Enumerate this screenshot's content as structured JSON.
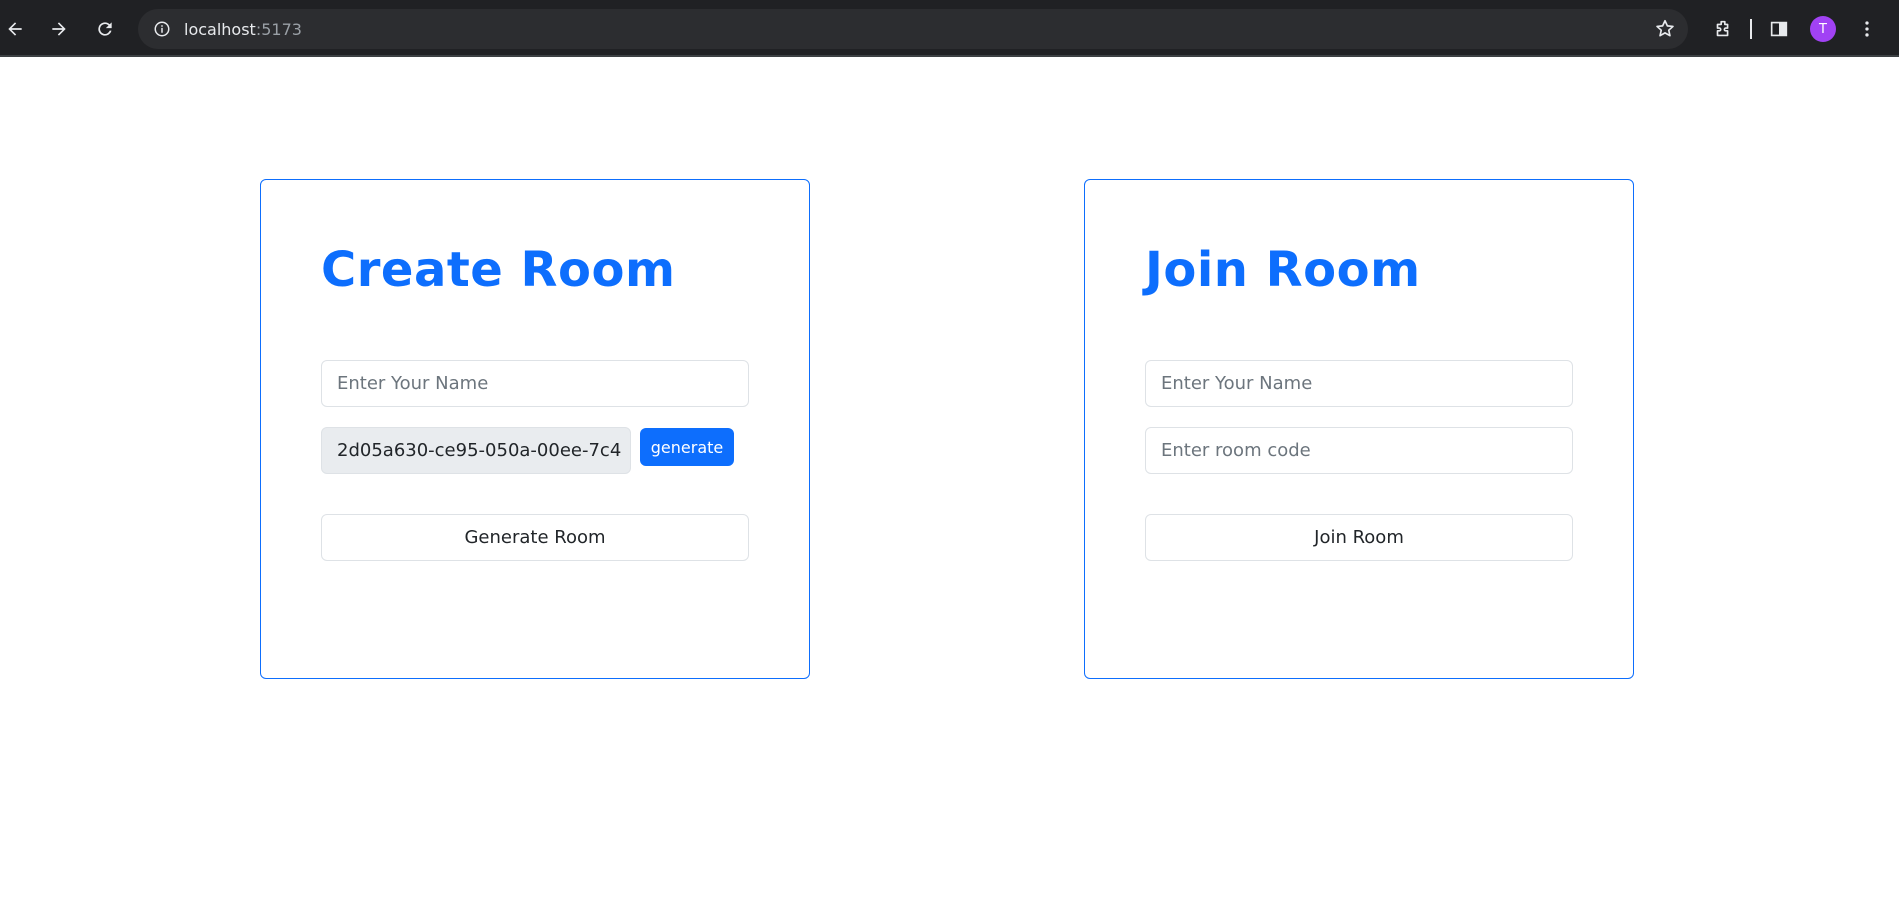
{
  "browser": {
    "url_host": "localhost",
    "url_port": ":5173",
    "avatar_letter": "T",
    "icons": [
      "back-arrow-icon",
      "forward-arrow-icon",
      "reload-icon",
      "site-info-icon",
      "star-icon",
      "extensions-icon",
      "side-panel-icon",
      "more-menu-icon"
    ],
    "colors": {
      "chrome_bg": "#202124",
      "omnibox_bg": "#2c2d30",
      "avatar_bg": "#a142f4"
    }
  },
  "create_room": {
    "title": "Create Room",
    "name_placeholder": "Enter Your Name",
    "room_id_value": "2d05a630-ce95-050a-00ee-7c4",
    "generate_label": "generate",
    "submit_label": "Generate Room"
  },
  "join_room": {
    "title": "Join Room",
    "name_placeholder": "Enter Your Name",
    "code_placeholder": "Enter room code",
    "submit_label": "Join Room"
  },
  "colors": {
    "accent": "#0d6efd",
    "input_border": "#dee2e6",
    "readonly_bg": "#e9ecef"
  }
}
